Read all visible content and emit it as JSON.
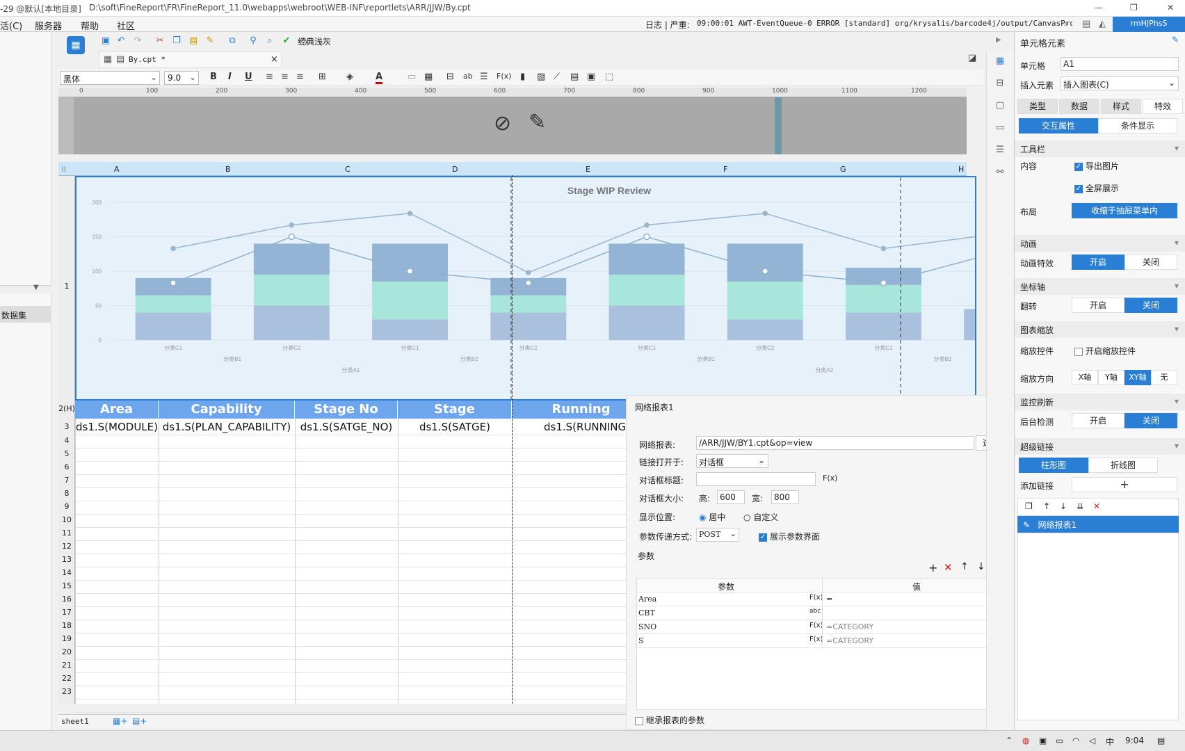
{
  "titlebar": {
    "left": "-29 @默认[本地目录]",
    "path": "D:\\soft\\FineReport\\FR\\FineReport_11.0\\webapps\\webroot\\WEB-INF\\reportlets\\ARR/JJW/By.cpt",
    "controls": [
      "—",
      "❐",
      "✕"
    ]
  },
  "menubar": {
    "items": [
      "活(C)",
      "服务器",
      "帮助",
      "社区"
    ],
    "log_prefix": "日志 | 严重:",
    "log": "09:00:01 AWT-EventQueue-0 ERROR [standard] org/krysalis/barcode4j/output/CanvasProvider",
    "user": "rmHJPhsS"
  },
  "toolbar": {
    "theme_label": "经典浅灰"
  },
  "tab": {
    "label": "By.cpt *",
    "close": "×"
  },
  "format": {
    "font": "黑体",
    "size": "9.0"
  },
  "ruler": [
    "0",
    "100",
    "200",
    "300",
    "400",
    "500",
    "600",
    "700",
    "800",
    "900",
    "1000",
    "1100",
    "1200"
  ],
  "columns": [
    "A",
    "B",
    "C",
    "D",
    "E",
    "F",
    "G",
    "H"
  ],
  "rows": [
    "1",
    "2(H)",
    "3",
    "4",
    "5",
    "6",
    "7",
    "8",
    "9",
    "10",
    "11",
    "12",
    "13",
    "14",
    "15",
    "16",
    "17",
    "18",
    "19",
    "20",
    "21",
    "22",
    "23"
  ],
  "chart_data": {
    "type": "bar+line",
    "title": "Stage WIP Review",
    "y_ticks": [
      "200",
      "150",
      "100",
      "50",
      "0"
    ],
    "ylim": [
      0,
      200
    ],
    "categories": [
      "分类C1",
      "分类C2",
      "分类C1",
      "分类C2",
      "分类C1",
      "分类C2",
      "分类C1",
      "分类C2"
    ],
    "groups_lvl2": [
      "分类B1",
      "分类B2",
      "分类B1",
      "分类B2"
    ],
    "groups_lvl1": [
      "分类A1",
      "分类A2"
    ],
    "stacked_bars": [
      {
        "name": "",
        "values": [
          40,
          50,
          30,
          40,
          50,
          30,
          40,
          45
        ],
        "color": "#a9c1dc"
      },
      {
        "name": "",
        "values": [
          25,
          45,
          55,
          25,
          45,
          55,
          40,
          0
        ],
        "color": "#a8e6dc"
      },
      {
        "name": "",
        "values": [
          25,
          45,
          55,
          25,
          45,
          55,
          25,
          0
        ],
        "color": "#93b4d4"
      }
    ],
    "lines": [
      {
        "name": "",
        "values": [
          133,
          167,
          184,
          98,
          167,
          184,
          133,
          155
        ],
        "color": "#99b6cf"
      },
      {
        "name": "",
        "values": [
          83,
          150,
          100,
          83,
          150,
          100,
          83,
          129
        ],
        "color": "#8fb2cc"
      }
    ]
  },
  "table_headers": [
    "Area",
    "Capability",
    "Stage No",
    "Stage",
    "Running"
  ],
  "table_row3": [
    "ds1.S(MODULE)",
    "ds1.S(PLAN_CAPABILITY)",
    "ds1.S(SATGE_NO)",
    "ds1.S(SATGE)",
    "ds1.S(RUNNING"
  ],
  "sheet": {
    "name": "sheet1"
  },
  "dialog": {
    "title": "网络报表1",
    "report_label": "网络报表:",
    "report_value": "/ARR/JJW/BY1.cpt&op=view",
    "choose": "选择",
    "open_label": "链接打开于:",
    "open_value": "对话框",
    "dlgtitle_label": "对话框标题:",
    "size_label": "对话框大小:",
    "h_label": "高:",
    "h_value": "600",
    "w_label": "宽:",
    "w_value": "800",
    "pos_label": "显示位置:",
    "pos_center": "居中",
    "pos_custom": "自定义",
    "method_label": "参数传递方式:",
    "method_value": "POST",
    "show_param": "展示参数界面",
    "params_label": "参数",
    "col_param": "参数",
    "col_value": "值",
    "params": [
      {
        "name": "Area",
        "value": "="
      },
      {
        "name": "CBT",
        "value": ""
      },
      {
        "name": "SNO",
        "value": "=CATEGORY"
      },
      {
        "name": "S",
        "value": "=CATEGORY"
      }
    ],
    "inherit": "继承报表的参数"
  },
  "right": {
    "title": "单元格元素",
    "cell_label": "单元格",
    "cell_value": "A1",
    "insert_label": "插入元素",
    "insert_value": "插入图表(C)",
    "tabs": [
      "类型",
      "数据",
      "样式",
      "特效"
    ],
    "subtabs": [
      "交互属性",
      "条件显示"
    ],
    "toolbar_sec": "工具栏",
    "content_label": "内容",
    "export_img": "导出图片",
    "fullscreen": "全屏展示",
    "layout_label": "布局",
    "layout_value": "收缩于抽屉菜单内",
    "anim_sec": "动画",
    "anim_label": "动画特效",
    "on": "开启",
    "off": "关闭",
    "axis_sec": "坐标轴",
    "flip_label": "翻转",
    "zoom_sec": "图表缩放",
    "zoom_ctrl_label": "缩放控件",
    "zoom_ctrl": "开启缩放控件",
    "zoom_dir_label": "缩放方向",
    "zoom_dirs": [
      "X轴",
      "Y轴",
      "XY轴",
      "无"
    ],
    "monitor_sec": "监控刷新",
    "bg_label": "后台检测",
    "hyper_sec": "超级链接",
    "hyper_tabs": [
      "柱形图",
      "折线图"
    ],
    "add_link": "添加链接",
    "link_item": "网络报表1"
  },
  "left": {
    "dataset": "数据集"
  },
  "taskbar": {
    "ime": "中",
    "time": "9:04"
  }
}
